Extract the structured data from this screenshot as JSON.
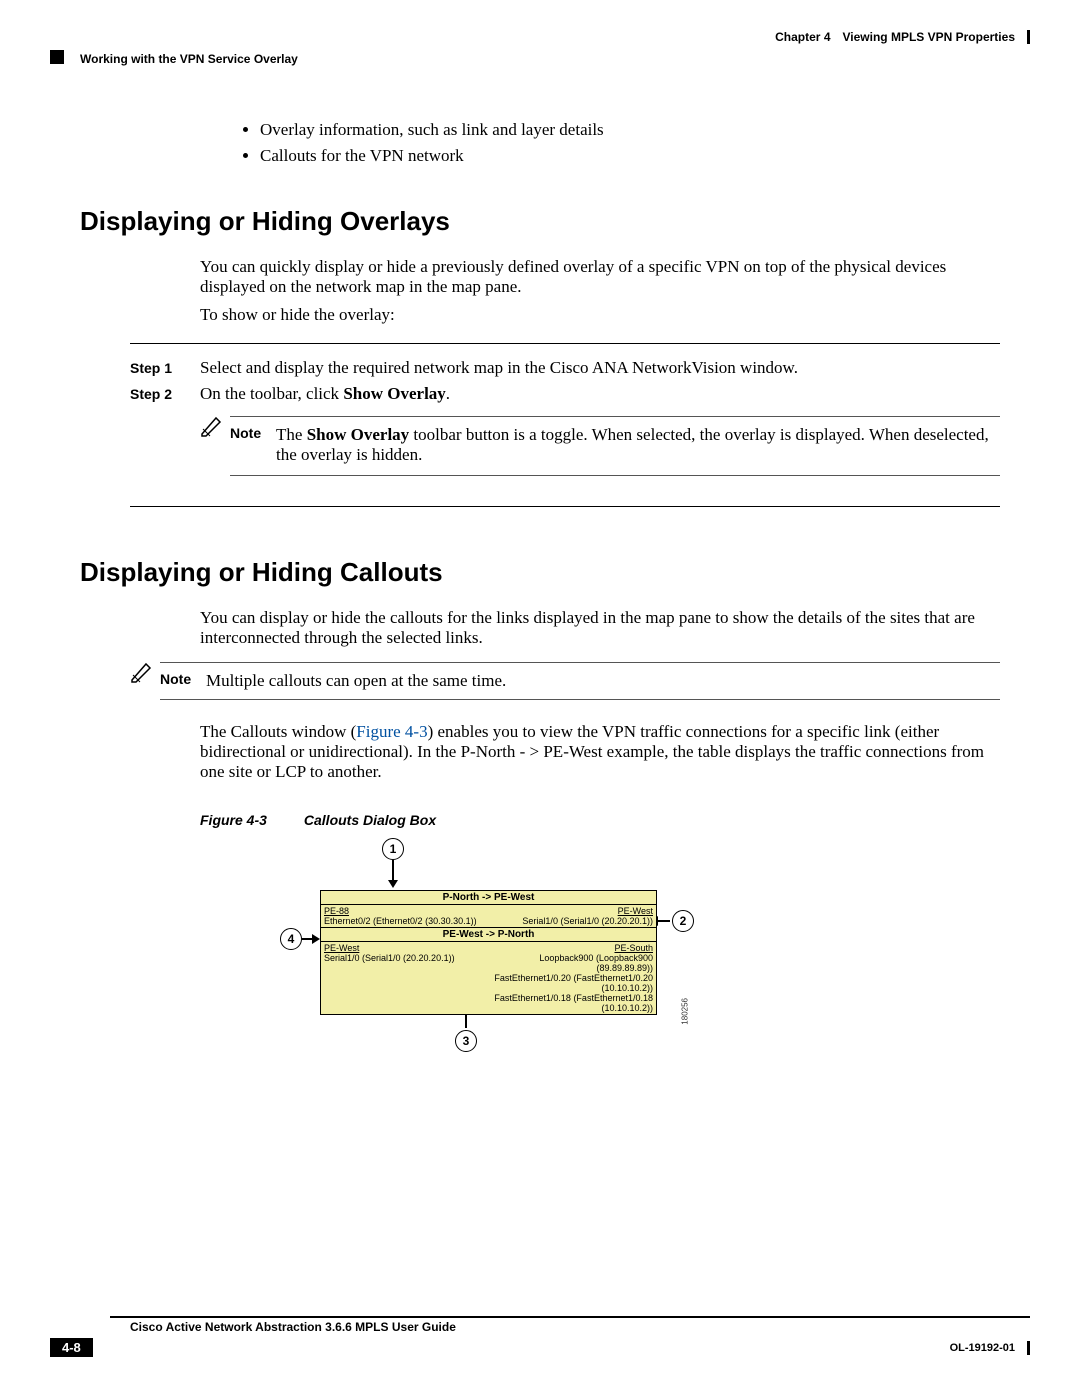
{
  "header": {
    "chapter_label": "Chapter 4",
    "chapter_title": "Viewing MPLS VPN Properties",
    "breadcrumb": "Working with the VPN Service Overlay"
  },
  "bullets": {
    "b1": "Overlay information, such as link and layer details",
    "b2": "Callouts for the VPN network"
  },
  "section1": {
    "title": "Displaying or Hiding Overlays",
    "p1": "You can quickly display or hide a previously defined overlay of a specific VPN on top of the physical devices displayed on the network map in the map pane.",
    "p2": "To show or hide the overlay:",
    "step1_label": "Step 1",
    "step1_body": "Select and display the required network map in the Cisco ANA NetworkVision window.",
    "step2_label": "Step 2",
    "step2_pre": "On the toolbar, click ",
    "step2_bold": "Show Overlay",
    "step2_post": ".",
    "note_label": "Note",
    "note_pre": "The ",
    "note_bold": "Show Overlay",
    "note_post": " toolbar button is a toggle. When selected, the overlay is displayed. When deselected, the overlay is hidden."
  },
  "section2": {
    "title": "Displaying or Hiding Callouts",
    "p1": "You can display or hide the callouts for the links displayed in the map pane to show the details of the sites that are interconnected through the selected links.",
    "note_label": "Note",
    "note_body": "Multiple callouts can open at the same time.",
    "p2_pre": "The Callouts window (",
    "p2_ref": "Figure 4-3",
    "p2_post": ") enables you to view the VPN traffic connections for a specific link (either bidirectional or unidirectional). In the P-North - > PE-West example, the table displays the traffic connections from one site or LCP to another."
  },
  "figure": {
    "num": "Figure 4-3",
    "title": "Callouts Dialog Box",
    "c1": "1",
    "c2": "2",
    "c3": "3",
    "c4": "4",
    "head1": "P-North -> PE-West",
    "r1l_name": "PE-88",
    "r1l_sub": "Ethernet0/2 (Ethernet0/2 (30.30.30.1))",
    "r1r_name": "PE-West",
    "r1r_sub": "Serial1/0 (Serial1/0 (20.20.20.1))",
    "head2": "PE-West -> P-North",
    "r2l_name": "PE-West",
    "r2l_sub": "Serial1/0 (Serial1/0 (20.20.20.1))",
    "r2r_name": "PE-South",
    "r2r_sub1": "Loopback900 (Loopback900 (89.89.89.89))",
    "r2r_sub2": "FastEthernet1/0.20 (FastEthernet1/0.20 (10.10.10.2))",
    "r2r_sub3": "FastEthernet1/0.18 (FastEthernet1/0.18 (10.10.10.2))",
    "sideid": "180256"
  },
  "footer": {
    "guide": "Cisco Active Network Abstraction 3.6.6 MPLS User Guide",
    "page": "4-8",
    "doc": "OL-19192-01"
  }
}
